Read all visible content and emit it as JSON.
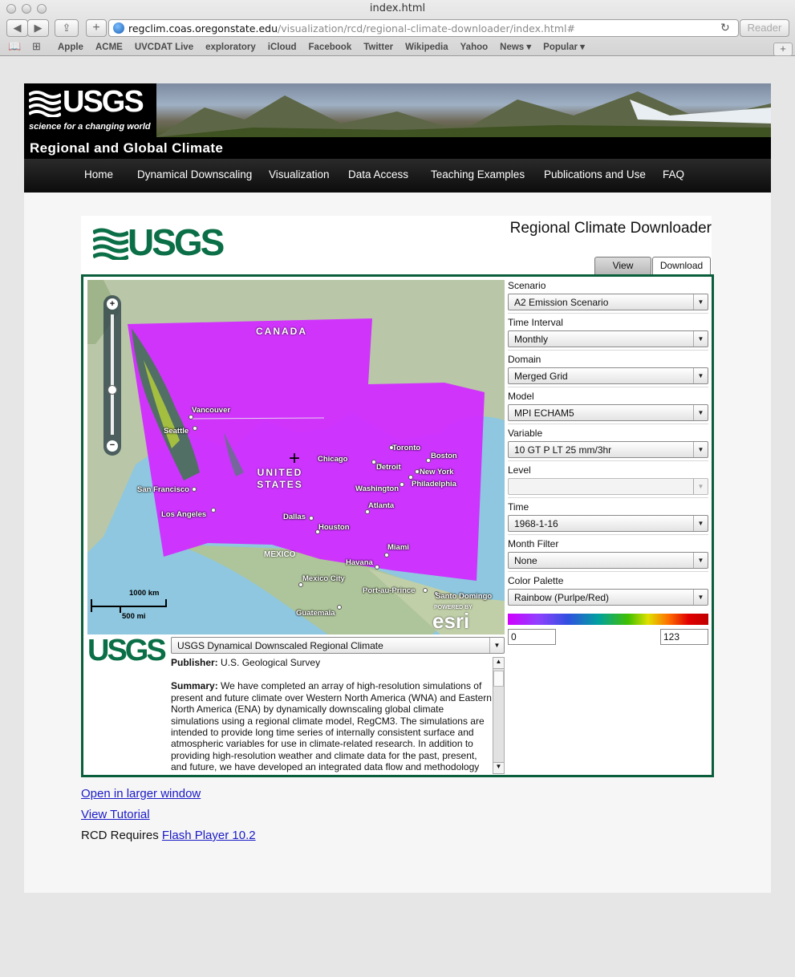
{
  "browser": {
    "window_title": "index.html",
    "url_host": "regclim.coas.oregonstate.edu",
    "url_path": "/visualization/rcd/regional-climate-downloader/index.html#",
    "reader_label": "Reader",
    "bookmarks": [
      "Apple",
      "ACME",
      "UVCDAT Live",
      "exploratory",
      "iCloud",
      "Facebook",
      "Twitter",
      "Wikipedia",
      "Yahoo",
      "News ▾",
      "Popular ▾"
    ]
  },
  "site": {
    "logo_text": "USGS",
    "logo_tagline": "science for a changing world",
    "name": "Regional and Global Climate",
    "nav": [
      "Home",
      "Dynamical Downscaling",
      "Visualization",
      "Data Access",
      "Teaching Examples",
      "Publications and Use",
      "FAQ"
    ]
  },
  "app": {
    "logo_text": "USGS",
    "title": "Regional Climate Downloader",
    "tabs": [
      "View",
      "Download"
    ],
    "active_tab": "View"
  },
  "map": {
    "country_labels": [
      "CANADA",
      "UNITED STATES",
      "MEXICO"
    ],
    "cities": [
      "Vancouver",
      "Seattle",
      "San Francisco",
      "Los Angeles",
      "Chicago",
      "Toronto",
      "Detroit",
      "Boston",
      "New York",
      "Philadelphia",
      "Washington",
      "Atlanta",
      "Dallas",
      "Houston",
      "Miami",
      "Havana",
      "Mexico City",
      "Port-au-Prince",
      "Santo Domingo",
      "Guatemala"
    ],
    "scale_km": "1000 km",
    "scale_mi": "500 mi",
    "esri_powered": "POWERED BY",
    "esri": "esri"
  },
  "controls": [
    {
      "label": "Scenario",
      "value": "A2 Emission Scenario"
    },
    {
      "label": "Time Interval",
      "value": "Monthly"
    },
    {
      "label": "Domain",
      "value": "Merged Grid"
    },
    {
      "label": "Model",
      "value": "MPI ECHAM5"
    },
    {
      "label": "Variable",
      "value": "10 GT P LT 25 mm/3hr"
    },
    {
      "label": "Level",
      "value": ""
    },
    {
      "label": "Time",
      "value": "1968-1-16"
    },
    {
      "label": "Month Filter",
      "value": "None"
    },
    {
      "label": "Color Palette",
      "value": "Rainbow (Purlpe/Red)"
    }
  ],
  "palette": {
    "min": "0",
    "max": "123"
  },
  "dataset": {
    "logo_text": "USGS",
    "selected": "USGS Dynamical Downscaled Regional Climate",
    "publisher_label": "Publisher:",
    "publisher": "U.S. Geological Survey",
    "summary_label": "Summary:",
    "summary": "We have completed an array of high-resolution simulations of present and future climate over Western North America (WNA) and Eastern North America (ENA) by dynamically downscaling global climate simulations using a regional climate model, RegCM3. The simulations are intended to provide long time series of internally consistent surface and atmospheric variables for use in climate-related research. In addition to providing high-resolution weather and climate data for the past, present, and future, we have developed an integrated data flow and methodology"
  },
  "links": {
    "larger": "Open in larger window",
    "tutorial": "View Tutorial",
    "requires": "RCD Requires",
    "flash": "Flash Player 10.2"
  }
}
